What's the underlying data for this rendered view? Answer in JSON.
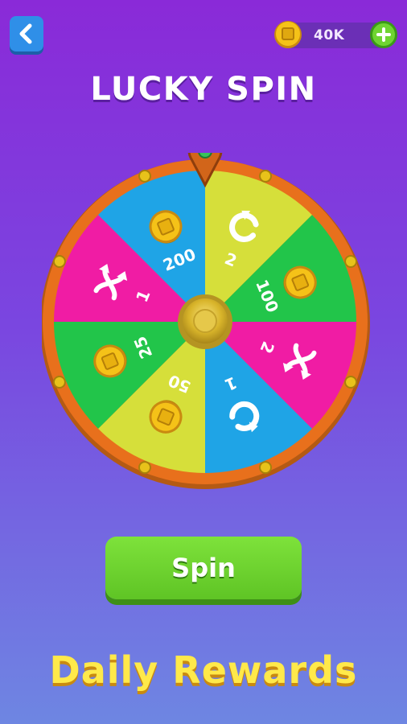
{
  "header": {
    "coin_amount": "40K"
  },
  "title": "LUCKY SPIN",
  "wheel": {
    "segments": [
      {
        "label": "2",
        "reward": "refresh-icon",
        "color": "#d6df3a"
      },
      {
        "label": "100",
        "reward": "coin-icon",
        "color": "#22c54a"
      },
      {
        "label": "2",
        "reward": "shuffle-icon",
        "color": "#f01ca4"
      },
      {
        "label": "1",
        "reward": "refresh-icon",
        "color": "#1fa4e6"
      },
      {
        "label": "50",
        "reward": "coin-icon",
        "color": "#d6df3a"
      },
      {
        "label": "25",
        "reward": "coin-icon",
        "color": "#22c54a"
      },
      {
        "label": "1",
        "reward": "shuffle-icon",
        "color": "#f01ca4"
      },
      {
        "label": "200",
        "reward": "coin-icon",
        "color": "#1fa4e6"
      }
    ],
    "rim_color": "#e8701c",
    "pointer_color": "#d2651a"
  },
  "spin_button": "Spin",
  "footer_text": "Daily Rewards"
}
